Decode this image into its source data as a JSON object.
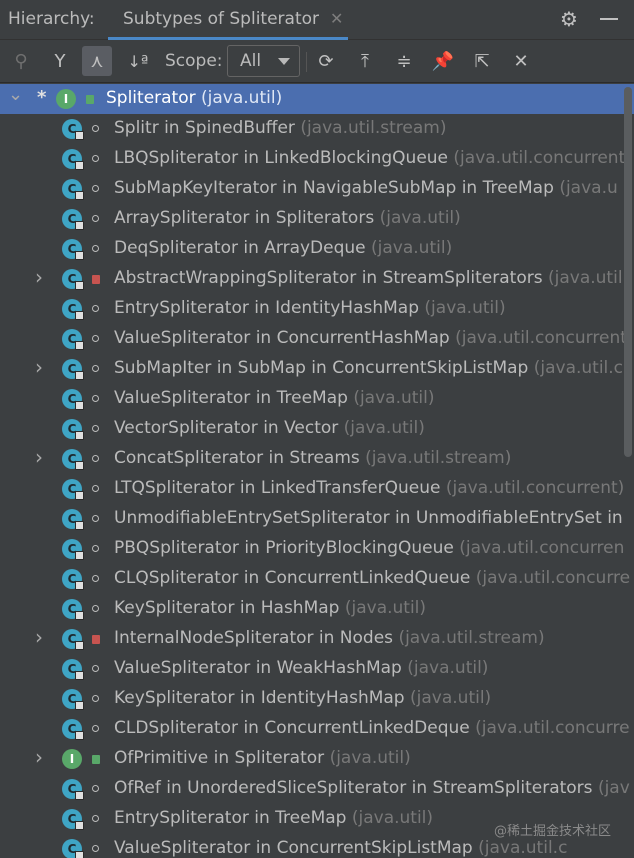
{
  "titlebar": {
    "label": "Hierarchy:",
    "tab_title": "Subtypes of Spliterator",
    "close_glyph": "✕",
    "gear_icon": "gear-icon",
    "minimize_icon": "minimize-icon"
  },
  "toolbar": {
    "scope_label": "Scope:",
    "scope_value": "All",
    "buttons": [
      "supertypes-hierarchy-icon",
      "subtypes-hierarchy-icon",
      "class-hierarchy-icon",
      "sort-alphabetically-icon",
      "refresh-icon",
      "export-icon",
      "expand-all-icon",
      "pin-icon",
      "open-in-window-icon",
      "close-icon"
    ],
    "sort_glyph": "↓ª"
  },
  "tree": {
    "rows": [
      {
        "name": "Spliterator",
        "pkg": "(java.util)",
        "kind": "iface",
        "selected": true,
        "expanded": true,
        "star": "*"
      },
      {
        "name": "Splitr in SpinedBuffer",
        "pkg": "(java.util.stream)",
        "kind": "class"
      },
      {
        "name": "LBQSpliterator in LinkedBlockingQueue",
        "pkg": "(java.util.concurrent",
        "kind": "class"
      },
      {
        "name": "SubMapKeyIterator in NavigableSubMap in TreeMap",
        "pkg": "(java.u",
        "kind": "class"
      },
      {
        "name": "ArraySpliterator in Spliterators",
        "pkg": "(java.util)",
        "kind": "class"
      },
      {
        "name": "DeqSpliterator in ArrayDeque",
        "pkg": "(java.util)",
        "kind": "class"
      },
      {
        "name": "AbstractWrappingSpliterator in StreamSpliterators",
        "pkg": "(java.util",
        "kind": "class",
        "collapsed": true,
        "lock": true
      },
      {
        "name": "EntrySpliterator in IdentityHashMap",
        "pkg": "(java.util)",
        "kind": "class"
      },
      {
        "name": "ValueSpliterator in ConcurrentHashMap",
        "pkg": "(java.util.concurrent",
        "kind": "class"
      },
      {
        "name": "SubMapIter in SubMap in ConcurrentSkipListMap",
        "pkg": "(java.util.c",
        "kind": "class",
        "collapsed": true
      },
      {
        "name": "ValueSpliterator in TreeMap",
        "pkg": "(java.util)",
        "kind": "class"
      },
      {
        "name": "VectorSpliterator in Vector",
        "pkg": "(java.util)",
        "kind": "class"
      },
      {
        "name": "ConcatSpliterator in Streams",
        "pkg": "(java.util.stream)",
        "kind": "class",
        "collapsed": true
      },
      {
        "name": "LTQSpliterator in LinkedTransferQueue",
        "pkg": "(java.util.concurrent)",
        "kind": "class"
      },
      {
        "name": "UnmodifiableEntrySetSpliterator in UnmodifiableEntrySet in",
        "pkg": "",
        "kind": "class"
      },
      {
        "name": "PBQSpliterator in PriorityBlockingQueue",
        "pkg": "(java.util.concurren",
        "kind": "class"
      },
      {
        "name": "CLQSpliterator in ConcurrentLinkedQueue",
        "pkg": "(java.util.concurre",
        "kind": "class"
      },
      {
        "name": "KeySpliterator in HashMap",
        "pkg": "(java.util)",
        "kind": "class"
      },
      {
        "name": "InternalNodeSpliterator in Nodes",
        "pkg": "(java.util.stream)",
        "kind": "class",
        "collapsed": true,
        "lock": true
      },
      {
        "name": "ValueSpliterator in WeakHashMap",
        "pkg": "(java.util)",
        "kind": "class"
      },
      {
        "name": "KeySpliterator in IdentityHashMap",
        "pkg": "(java.util)",
        "kind": "class"
      },
      {
        "name": "CLDSpliterator in ConcurrentLinkedDeque",
        "pkg": "(java.util.concurre",
        "kind": "class"
      },
      {
        "name": "OfPrimitive in Spliterator",
        "pkg": "(java.util)",
        "kind": "iface",
        "collapsed": true,
        "open": true
      },
      {
        "name": "OfRef in UnorderedSliceSpliterator in StreamSpliterators",
        "pkg": "(jav",
        "kind": "class"
      },
      {
        "name": "EntrySpliterator in TreeMap",
        "pkg": "(java.util)",
        "kind": "class"
      },
      {
        "name": "ValueSpliterator in ConcurrentSkipListMap",
        "pkg": "(java.util.c",
        "kind": "class"
      }
    ]
  },
  "watermark": "@稀土掘金技术社区"
}
